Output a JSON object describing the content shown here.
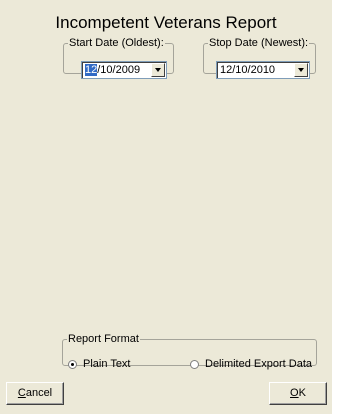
{
  "report": {
    "title": "Incompetent Veterans Report"
  },
  "start_date": {
    "legend": "Start Date (Oldest):",
    "selected_part": "12",
    "rest": "/10/2009"
  },
  "stop_date": {
    "legend": "Stop Date (Newest):",
    "value": "12/10/2010"
  },
  "report_format": {
    "legend": "Report Format",
    "options": [
      {
        "label": "Plain Text",
        "checked": true
      },
      {
        "label": "Delimited Export Data",
        "checked": false
      }
    ]
  },
  "buttons": {
    "cancel_mnemonic": "C",
    "cancel_rest": "ancel",
    "ok_mnemonic": "O",
    "ok_rest": "K"
  },
  "colors": {
    "form_background": "#ece9d8",
    "selection_highlight": "#316ac5"
  }
}
